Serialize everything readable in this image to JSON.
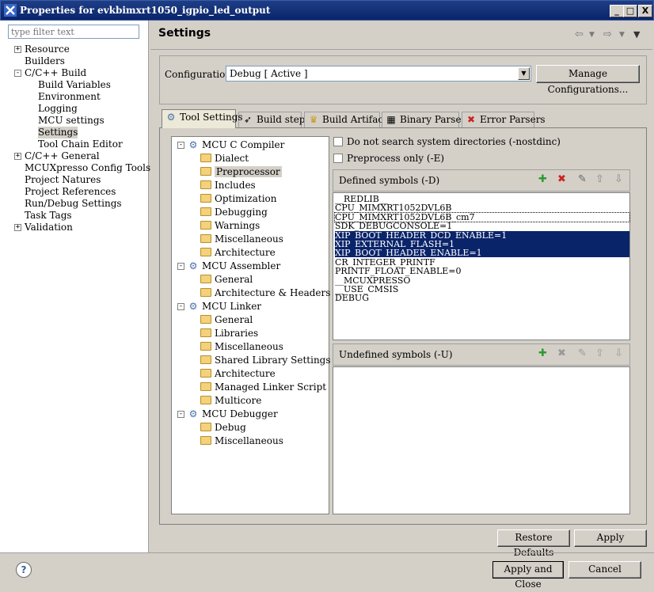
{
  "window": {
    "title": "Properties for evkbimxrt1050_igpio_led_output",
    "min_btn": "_",
    "max_btn": "□",
    "close_btn": "X"
  },
  "filter": {
    "placeholder": "type filter text"
  },
  "left_tree": [
    {
      "label": "Resource",
      "expander": "+"
    },
    {
      "label": "Builders",
      "expander": ""
    },
    {
      "label": "C/C++ Build",
      "expander": "-"
    },
    {
      "label": "Build Variables",
      "expander": ""
    },
    {
      "label": "Environment",
      "expander": ""
    },
    {
      "label": "Logging",
      "expander": ""
    },
    {
      "label": "MCU settings",
      "expander": ""
    },
    {
      "label": "Settings",
      "expander": "",
      "selected": true
    },
    {
      "label": "Tool Chain Editor",
      "expander": ""
    },
    {
      "label": "C/C++ General",
      "expander": "+"
    },
    {
      "label": "MCUXpresso Config Tools",
      "expander": ""
    },
    {
      "label": "Project Natures",
      "expander": ""
    },
    {
      "label": "Project References",
      "expander": ""
    },
    {
      "label": "Run/Debug Settings",
      "expander": ""
    },
    {
      "label": "Task Tags",
      "expander": ""
    },
    {
      "label": "Validation",
      "expander": "+"
    }
  ],
  "header": {
    "title": "Settings",
    "back_icon": "⇦",
    "forward_icon": "⇨",
    "menu_icon": "▼"
  },
  "configuration": {
    "label": "Configuration:",
    "value": "Debug  [ Active ]",
    "manage_button": "Manage Configurations..."
  },
  "tabs": [
    {
      "label": "Tool Settings",
      "icon": "⚙",
      "active": true
    },
    {
      "label": "Build steps",
      "icon": "➶"
    },
    {
      "label": "Build Artifact",
      "icon": "♛"
    },
    {
      "label": "Binary Parsers",
      "icon": "▦"
    },
    {
      "label": "Error Parsers",
      "icon": "✖"
    }
  ],
  "tool_tree": [
    {
      "label": "MCU C Compiler",
      "kind": "tool",
      "expander": "-"
    },
    {
      "label": "Dialect",
      "kind": "option"
    },
    {
      "label": "Preprocessor",
      "kind": "option",
      "selected": true
    },
    {
      "label": "Includes",
      "kind": "option"
    },
    {
      "label": "Optimization",
      "kind": "option"
    },
    {
      "label": "Debugging",
      "kind": "option"
    },
    {
      "label": "Warnings",
      "kind": "option"
    },
    {
      "label": "Miscellaneous",
      "kind": "option"
    },
    {
      "label": "Architecture",
      "kind": "option"
    },
    {
      "label": "MCU Assembler",
      "kind": "tool",
      "expander": "-"
    },
    {
      "label": "General",
      "kind": "option"
    },
    {
      "label": "Architecture & Headers",
      "kind": "option"
    },
    {
      "label": "MCU Linker",
      "kind": "tool",
      "expander": "-"
    },
    {
      "label": "General",
      "kind": "option"
    },
    {
      "label": "Libraries",
      "kind": "option"
    },
    {
      "label": "Miscellaneous",
      "kind": "option"
    },
    {
      "label": "Shared Library Settings",
      "kind": "option"
    },
    {
      "label": "Architecture",
      "kind": "option"
    },
    {
      "label": "Managed Linker Script",
      "kind": "option"
    },
    {
      "label": "Multicore",
      "kind": "option"
    },
    {
      "label": "MCU Debugger",
      "kind": "tool",
      "expander": "-"
    },
    {
      "label": "Debug",
      "kind": "option"
    },
    {
      "label": "Miscellaneous",
      "kind": "option"
    }
  ],
  "options": {
    "nostdinc": "Do not search system directories (-nostdinc)",
    "preprocess_only": "Preprocess only (-E)"
  },
  "defined_symbols": {
    "title": "Defined symbols (-D)",
    "items": [
      {
        "text": "__REDLIB__"
      },
      {
        "text": "CPU_MIMXRT1052DVL6B"
      },
      {
        "text": "CPU_MIMXRT1052DVL6B_cm7",
        "focus": true
      },
      {
        "text": "SDK_DEBUGCONSOLE=1"
      },
      {
        "text": "XIP_BOOT_HEADER_DCD_ENABLE=1",
        "selected": true
      },
      {
        "text": "XIP_EXTERNAL_FLASH=1",
        "selected": true
      },
      {
        "text": "XIP_BOOT_HEADER_ENABLE=1",
        "selected": true
      },
      {
        "text": "CR_INTEGER_PRINTF"
      },
      {
        "text": "PRINTF_FLOAT_ENABLE=0"
      },
      {
        "text": "__MCUXPRESSO"
      },
      {
        "text": "__USE_CMSIS"
      },
      {
        "text": "DEBUG"
      }
    ]
  },
  "undefined_symbols": {
    "title": "Undefined symbols (-U)"
  },
  "toolbar_icons": {
    "add": "✚",
    "delete": "✖",
    "edit": "✎",
    "up": "⇧",
    "down": "⇩"
  },
  "buttons": {
    "restore_defaults": "Restore Defaults",
    "apply": "Apply",
    "apply_close": "Apply and Close",
    "cancel": "Cancel"
  },
  "help": "?"
}
